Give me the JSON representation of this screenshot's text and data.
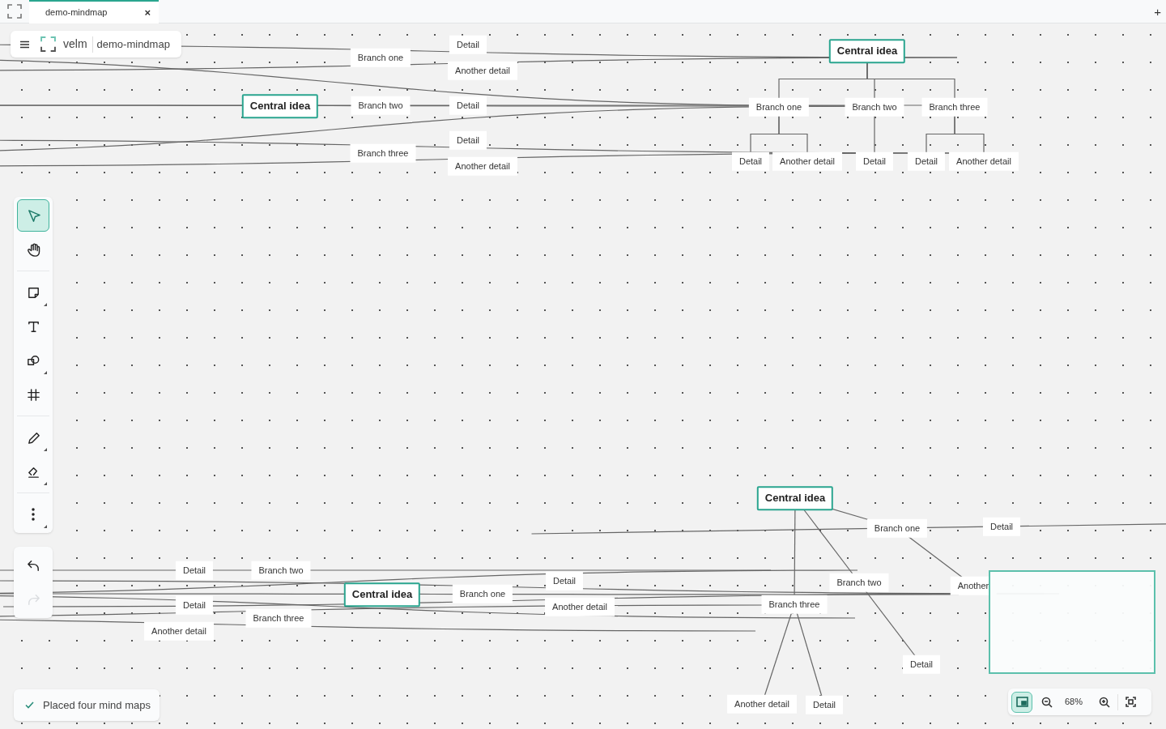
{
  "tab": {
    "title": "demo-mindmap",
    "close": "×",
    "new": "+"
  },
  "header": {
    "app": "velm",
    "document": "demo-mindmap"
  },
  "tool_groups": [
    {
      "tools": [
        {
          "kind": "select",
          "selected": true,
          "submenu": false
        },
        {
          "kind": "hand",
          "selected": false,
          "submenu": false
        }
      ]
    },
    {
      "tools": [
        {
          "kind": "note",
          "selected": false,
          "submenu": true
        },
        {
          "kind": "text",
          "selected": false,
          "submenu": false
        },
        {
          "kind": "shapes",
          "selected": false,
          "submenu": true
        },
        {
          "kind": "frame",
          "selected": false,
          "submenu": false
        }
      ]
    },
    {
      "tools": [
        {
          "kind": "pencil",
          "selected": false,
          "submenu": true
        },
        {
          "kind": "eraser",
          "selected": false,
          "submenu": true
        }
      ]
    },
    {
      "tools": [
        {
          "kind": "more",
          "selected": false,
          "submenu": true
        }
      ]
    }
  ],
  "history": [
    {
      "kind": "undo",
      "disabled": false
    },
    {
      "kind": "redo",
      "disabled": true
    }
  ],
  "maps": [
    {
      "kind": "right",
      "root": {
        "text": "Central idea",
        "children": [
          {
            "text": "Branch one",
            "children": [
              {
                "text": "Detail"
              },
              {
                "text": "Another detail"
              }
            ]
          },
          {
            "text": "Branch two",
            "children": [
              {
                "text": "Detail"
              }
            ]
          },
          {
            "text": "Branch three",
            "children": [
              {
                "text": "Detail"
              },
              {
                "text": "Another detail"
              }
            ]
          }
        ]
      }
    },
    {
      "kind": "tree",
      "root": {
        "text": "Central idea",
        "children": [
          {
            "text": "Branch one",
            "children": [
              {
                "text": "Detail"
              },
              {
                "text": "Another detail"
              }
            ]
          },
          {
            "text": "Branch two",
            "children": [
              {
                "text": "Detail"
              }
            ]
          },
          {
            "text": "Branch three",
            "children": [
              {
                "text": "Detail"
              },
              {
                "text": "Another detail"
              }
            ]
          }
        ]
      }
    },
    {
      "kind": "both",
      "root": {
        "text": "Central idea",
        "children": [
          {
            "text": "Branch one",
            "children": [
              {
                "text": "Detail"
              },
              {
                "text": "Another detail"
              }
            ]
          },
          {
            "text": "Branch two",
            "children": [
              {
                "text": "Detail"
              }
            ]
          },
          {
            "text": "Branch three",
            "children": [
              {
                "text": "Detail"
              },
              {
                "text": "Another detail"
              }
            ]
          }
        ]
      }
    },
    {
      "kind": "radial",
      "root": {
        "text": "Central idea",
        "children": [
          {
            "text": "Branch one",
            "children": [
              {
                "text": "Detail"
              },
              {
                "text": "Another"
              }
            ]
          },
          {
            "text": "Branch two",
            "children": [
              {
                "text": "Detail"
              }
            ]
          },
          {
            "text": "Branch three",
            "children": [
              {
                "text": "Another detail"
              },
              {
                "text": "Detail"
              }
            ]
          }
        ]
      }
    }
  ],
  "minimap": {
    "selected": true
  },
  "zoom": {
    "level_text": "68%"
  },
  "toast": {
    "text": "Placed four mind maps"
  }
}
